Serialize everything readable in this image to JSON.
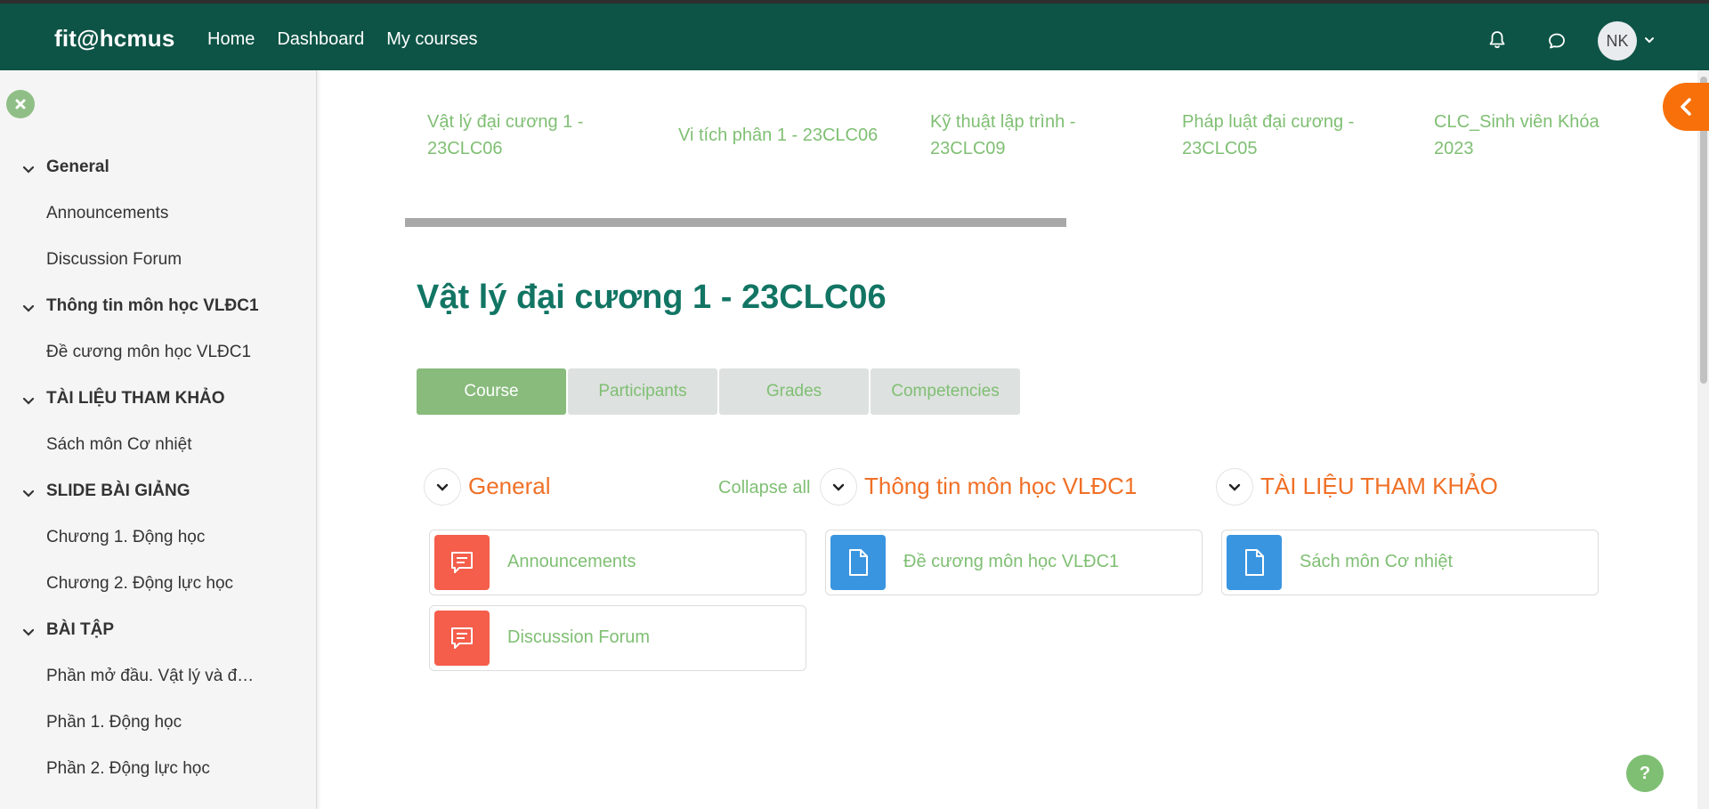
{
  "topbar": {
    "brand": "fit@hcmus",
    "nav": [
      "Home",
      "Dashboard",
      "My courses"
    ],
    "user_initials": "NK"
  },
  "sidebar": {
    "items": [
      {
        "label": "General",
        "section": true
      },
      {
        "label": "Announcements",
        "section": false
      },
      {
        "label": "Discussion Forum",
        "section": false
      },
      {
        "label": "Thông tin môn học VLĐC1",
        "section": true
      },
      {
        "label": "Đề cương môn học VLĐC1",
        "section": false
      },
      {
        "label": "TÀI LIỆU THAM KHẢO",
        "section": true
      },
      {
        "label": "Sách môn Cơ nhiệt",
        "section": false
      },
      {
        "label": "SLIDE BÀI GIẢNG",
        "section": true
      },
      {
        "label": "Chương 1. Động học",
        "section": false
      },
      {
        "label": "Chương 2. Động lực học",
        "section": false
      },
      {
        "label": "BÀI TẬP",
        "section": true
      },
      {
        "label": "Phần mở đầu. Vật lý và đ…",
        "section": false
      },
      {
        "label": "Phần 1. Động học",
        "section": false
      },
      {
        "label": "Phần 2. Động lực học",
        "section": false
      }
    ]
  },
  "course_links": [
    {
      "line1": "Vật lý đại cương 1 -",
      "line2": "23CLC06"
    },
    {
      "line1": "Vi tích phân 1 - 23CLC06",
      "line2": ""
    },
    {
      "line1": "Kỹ thuật lập trình -",
      "line2": "23CLC09"
    },
    {
      "line1": "Pháp luật đại cương -",
      "line2": "23CLC05"
    },
    {
      "line1": "CLC_Sinh viên Khóa",
      "line2": "2023"
    }
  ],
  "page": {
    "title": "Vật lý đại cương 1 - 23CLC06",
    "tabs": [
      "Course",
      "Participants",
      "Grades",
      "Competencies"
    ],
    "active_tab": "Course",
    "collapse_all": "Collapse all"
  },
  "sections": [
    {
      "title": "General",
      "activities": [
        {
          "label": "Announcements",
          "type": "forum"
        },
        {
          "label": "Discussion Forum",
          "type": "forum"
        }
      ]
    },
    {
      "title": "Thông tin môn học VLĐC1",
      "activities": [
        {
          "label": "Đề cương môn học VLĐC1",
          "type": "file"
        }
      ]
    },
    {
      "title": "TÀI LIỆU THAM KHẢO",
      "activities": [
        {
          "label": "Sách môn Cơ nhiệt",
          "type": "file"
        }
      ]
    }
  ],
  "help_label": "?",
  "colors": {
    "topbar": "#0d5446",
    "accent_green": "#7fbf73",
    "section_orange": "#f07026",
    "title_teal": "#127564",
    "forum_icon": "#f45e4b",
    "file_icon": "#3a95e0"
  }
}
